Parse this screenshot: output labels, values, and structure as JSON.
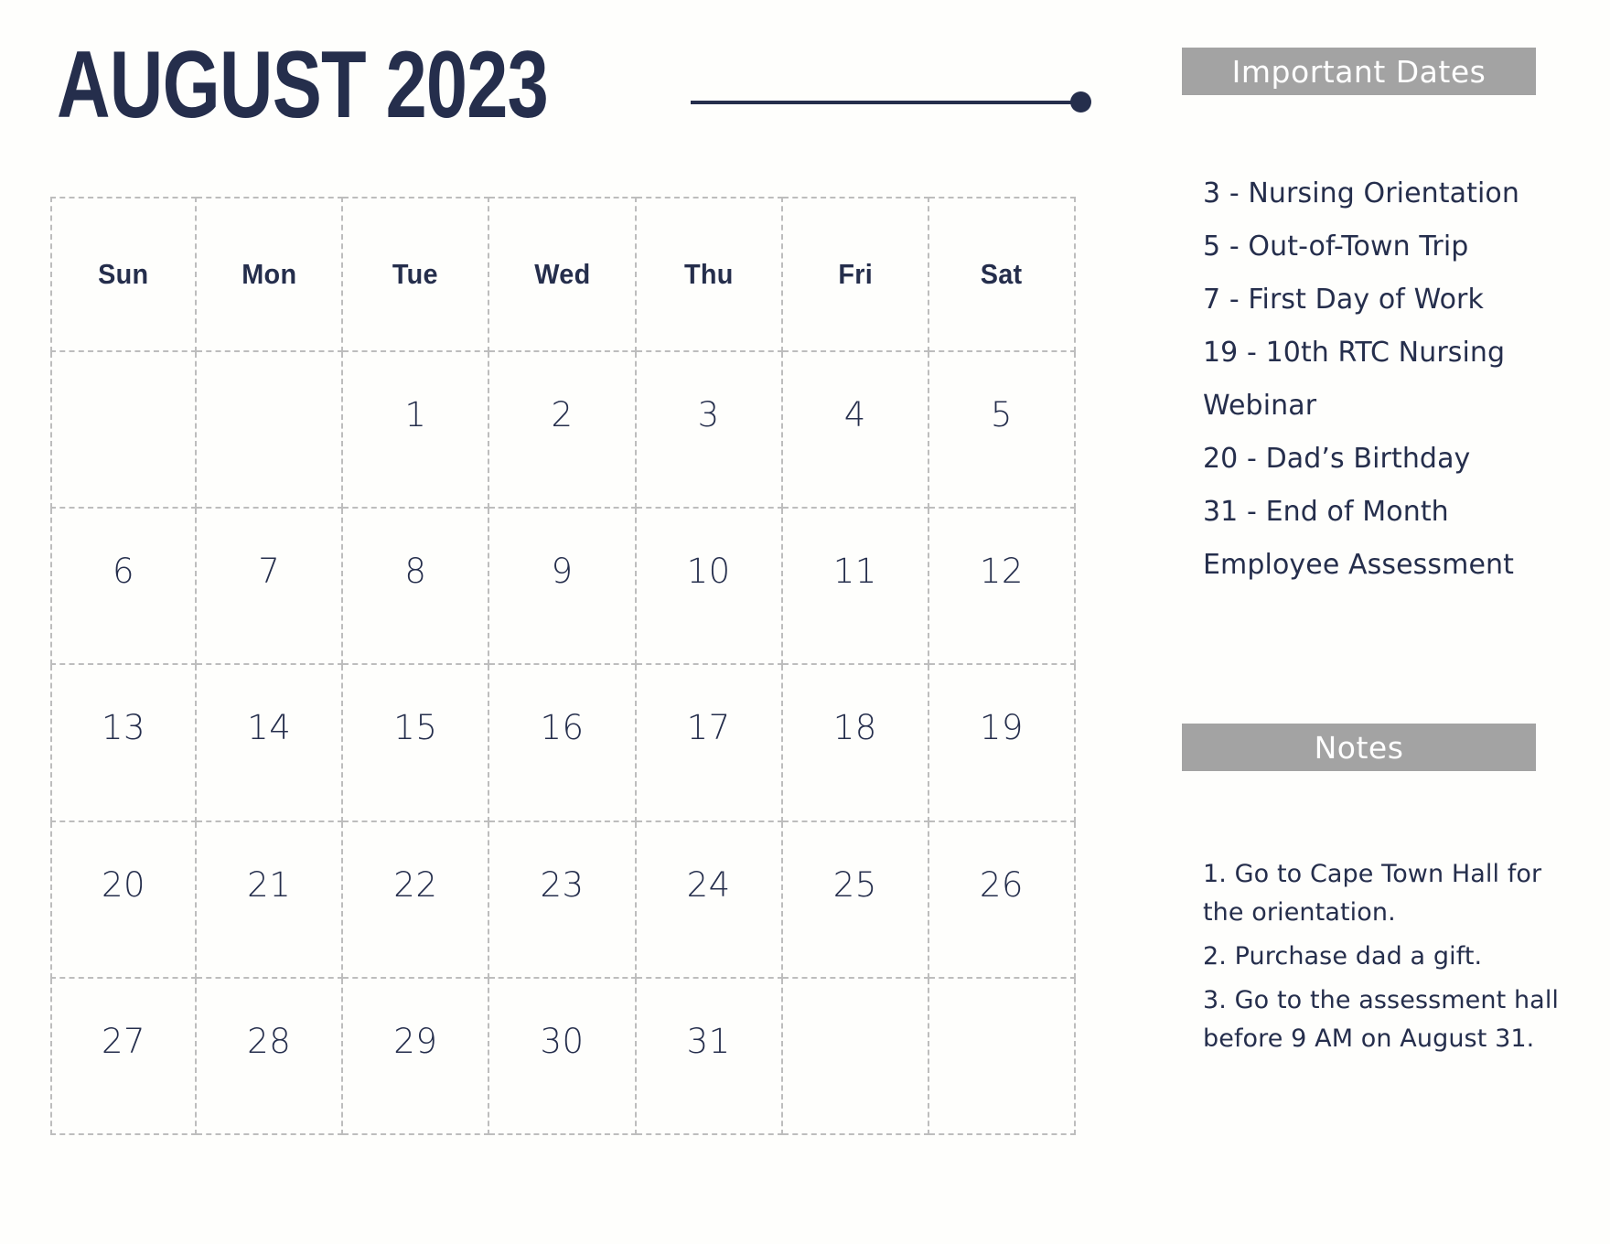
{
  "header": {
    "month_title": "AUGUST 2023",
    "accent_color": "#252E4C",
    "rule_color": "#252E4C"
  },
  "calendar": {
    "day_names": [
      "Sun",
      "Mon",
      "Tue",
      "Wed",
      "Thu",
      "Fri",
      "Sat"
    ],
    "grid_border_color": "#BDBDBD",
    "weeks": [
      [
        "",
        "",
        "1",
        "2",
        "3",
        "4",
        "5"
      ],
      [
        "6",
        "7",
        "8",
        "9",
        "10",
        "11",
        "12"
      ],
      [
        "13",
        "14",
        "15",
        "16",
        "17",
        "18",
        "19"
      ],
      [
        "20",
        "21",
        "22",
        "23",
        "24",
        "25",
        "26"
      ],
      [
        "27",
        "28",
        "29",
        "30",
        "31",
        "",
        ""
      ]
    ]
  },
  "important_dates": {
    "title": "Important Dates",
    "header_bg": "#A3A3A3",
    "header_text_color": "#FFFFFF",
    "items": [
      "3 - Nursing Orientation",
      "5 - Out-of-Town Trip",
      "7 - First Day of Work",
      "19 - 10th RTC Nursing Webinar",
      "20 - Dad’s Birthday",
      "31 - End of Month Employee Assessment"
    ]
  },
  "notes": {
    "title": "Notes",
    "header_bg": "#A3A3A3",
    "header_text_color": "#FFFFFF",
    "items": [
      "1. Go to Cape Town Hall for the orientation.",
      "2. Purchase dad a gift.",
      "3. Go to the assessment hall before 9 AM on August 31."
    ]
  }
}
